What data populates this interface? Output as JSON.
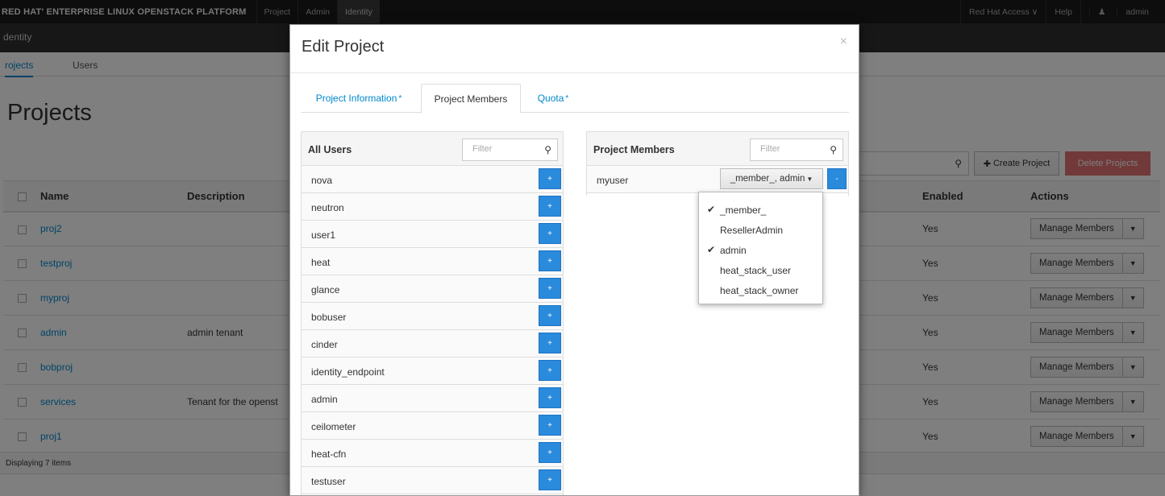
{
  "topbar": {
    "brand": "RED HAT' ENTERPRISE LINUX OPENSTACK PLATFORM",
    "nav": [
      "Project",
      "Admin",
      "Identity"
    ],
    "right": [
      "Red Hat Access ∨",
      "Help",
      "admin"
    ]
  },
  "subbar": {
    "label": "dentity"
  },
  "page_tabs": [
    "rojects",
    "Users"
  ],
  "page": {
    "title": "Projects",
    "create_label": "Create Project",
    "delete_label": "Delete Projects",
    "columns": {
      "name": "Name",
      "description": "Description",
      "enabled": "Enabled",
      "actions": "Actions"
    },
    "rows": [
      {
        "name": "proj2",
        "description": "",
        "enabled": "Yes"
      },
      {
        "name": "testproj",
        "description": "",
        "enabled": "Yes"
      },
      {
        "name": "myproj",
        "description": "",
        "enabled": "Yes"
      },
      {
        "name": "admin",
        "description": "admin tenant",
        "enabled": "Yes"
      },
      {
        "name": "bobproj",
        "description": "",
        "enabled": "Yes"
      },
      {
        "name": "services",
        "description": "Tenant for the openst",
        "enabled": "Yes"
      },
      {
        "name": "proj1",
        "description": "",
        "enabled": "Yes"
      }
    ],
    "manage_label": "Manage Members",
    "footer": "Displaying 7 items"
  },
  "modal": {
    "title": "Edit Project",
    "close": "×",
    "tabs": {
      "info": "Project Information",
      "members": "Project Members",
      "quota": "Quota"
    },
    "required_mark": "*",
    "all_users": {
      "title": "All Users",
      "filter_placeholder": "Filter",
      "users": [
        "nova",
        "neutron",
        "user1",
        "heat",
        "glance",
        "bobuser",
        "cinder",
        "identity_endpoint",
        "admin",
        "ceilometer",
        "heat-cfn",
        "testuser"
      ],
      "add_glyph": "+"
    },
    "project_members": {
      "title": "Project Members",
      "filter_placeholder": "Filter",
      "member_name": "myuser",
      "roles_label": "_member_, admin",
      "remove_glyph": "-"
    },
    "roles_dropdown": [
      {
        "label": "_member_",
        "checked": true
      },
      {
        "label": "ResellerAdmin",
        "checked": false
      },
      {
        "label": "admin",
        "checked": true
      },
      {
        "label": "heat_stack_user",
        "checked": false
      },
      {
        "label": "heat_stack_owner",
        "checked": false
      }
    ]
  },
  "icons": {
    "search": "search-icon",
    "plus": "plus-icon",
    "check": "check-icon",
    "user": "user-icon",
    "caret": "caret-down-icon"
  },
  "colors": {
    "link": "#0088ce",
    "primary": "#2a8adc",
    "danger": "#cc0000",
    "topbar": "#1b1b1b"
  }
}
